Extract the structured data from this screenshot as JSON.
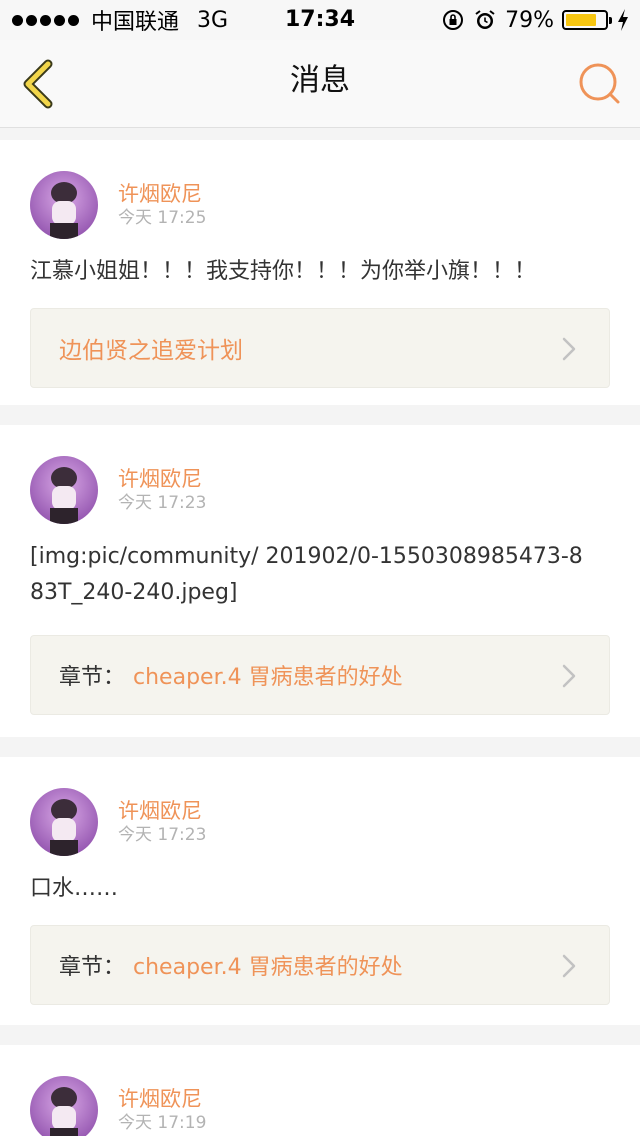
{
  "status_bar": {
    "carrier": "中国联通",
    "network": "3G",
    "time": "17:34",
    "battery": "79%",
    "battery_level": 0.79,
    "battery_color": "#f6c510"
  },
  "nav": {
    "title": "消息",
    "back_icon": "chevron-left-icon",
    "search_icon": "search-icon",
    "accent_color": "#ef9358"
  },
  "messages": [
    {
      "username": "许烟欧尼",
      "time": "今天 17:25",
      "content": "江慕小姐姐！！！我支持你！！！为你举小旗！！！",
      "link_prefix": "",
      "link_text": "边伯贤之追爱计划"
    },
    {
      "username": "许烟欧尼",
      "time": "今天 17:23",
      "content": "[img:pic/community/ 201902/0-1550308985473-883T_240-240.jpeg]",
      "link_prefix": "章节：",
      "link_text": "cheaper.4 胃病患者的好处"
    },
    {
      "username": "许烟欧尼",
      "time": "今天 17:23",
      "content": "口水……",
      "link_prefix": "章节：",
      "link_text": "cheaper.4 胃病患者的好处"
    },
    {
      "username": "许烟欧尼",
      "time": "今天 17:19"
    }
  ]
}
